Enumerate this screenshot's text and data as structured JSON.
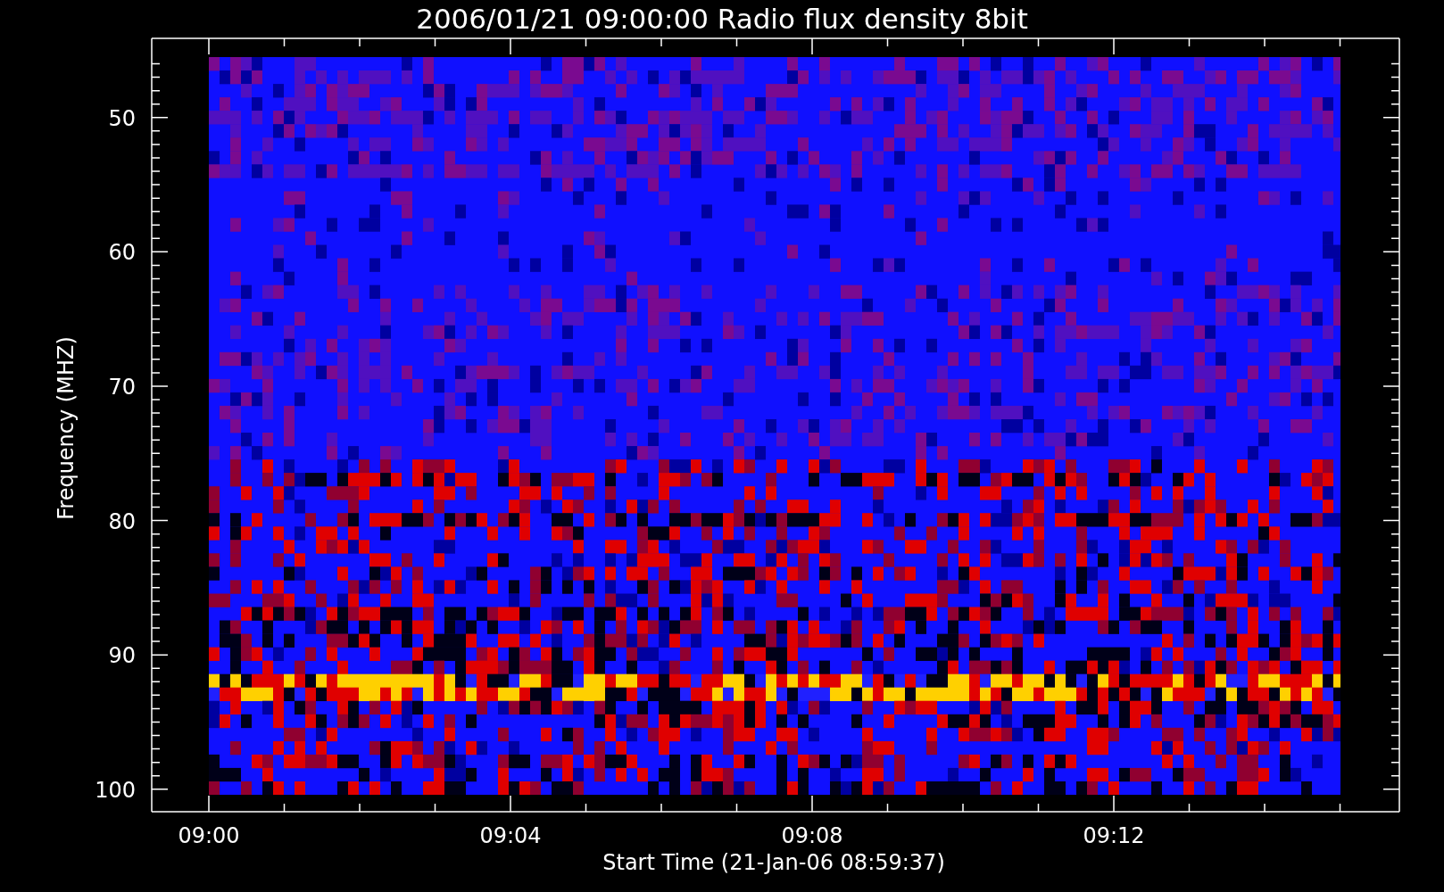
{
  "title": "2006/01/21 09:00:00 Radio flux density 8bit",
  "y_axis": {
    "title": "Frequency (MHZ)",
    "tick_labels": [
      "50",
      "60",
      "70",
      "80",
      "90",
      "100"
    ]
  },
  "x_axis": {
    "title": "Start Time (21-Jan-06 08:59:37)",
    "tick_labels": [
      "09:00",
      "09:04",
      "09:08",
      "09:12"
    ]
  }
}
